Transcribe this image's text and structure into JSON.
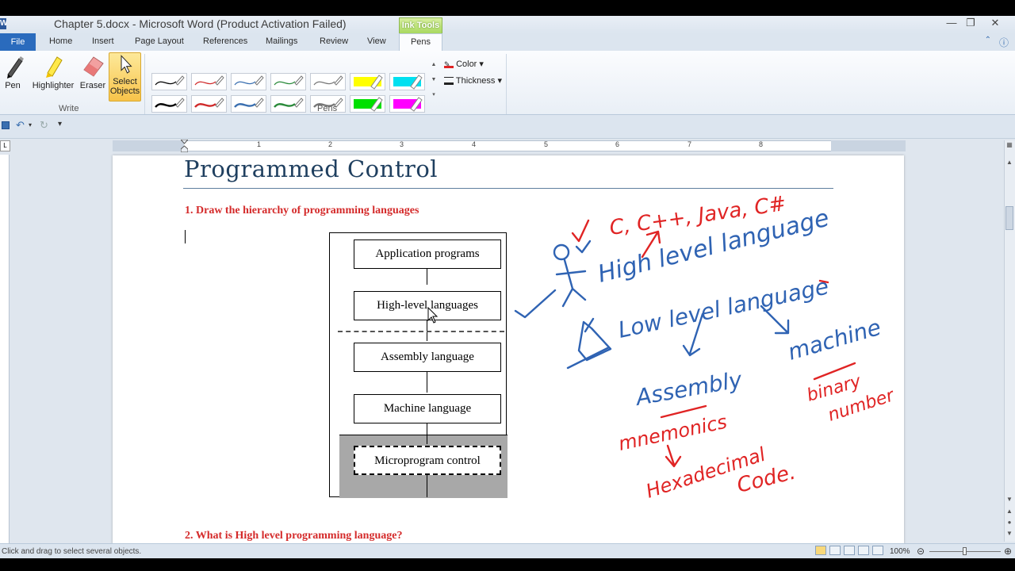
{
  "window": {
    "title": "Chapter 5.docx - Microsoft Word (Product Activation Failed)",
    "app_icon": "W",
    "contextual_tab_group": "Ink Tools",
    "minimize": "—",
    "restore": "❐",
    "close": "✕"
  },
  "tabs": {
    "file": "File",
    "home": "Home",
    "insert": "Insert",
    "page_layout": "Page Layout",
    "references": "References",
    "mailings": "Mailings",
    "review": "Review",
    "view": "View",
    "pens": "Pens"
  },
  "ribbon": {
    "write_group": "Write",
    "pens_group": "Pens",
    "pen": "Pen",
    "highlighter": "Highlighter",
    "eraser": "Eraser",
    "select_objects_1": "Select",
    "select_objects_2": "Objects",
    "color": "Color",
    "thickness": "Thickness",
    "pen_colors_row1": [
      "#000000",
      "#d02a2a",
      "#3a6fb0",
      "#2a8a3a",
      "#777777",
      "#ffff00",
      "#00e0f0"
    ],
    "pen_colors_row2": [
      "#000000",
      "#d02a2a",
      "#3a6fb0",
      "#2a8a3a",
      "#777777",
      "#00e000",
      "#ff00ff"
    ]
  },
  "ruler": {
    "numbers": [
      "1",
      "1",
      "2",
      "3",
      "4",
      "5",
      "6",
      "7",
      "8"
    ]
  },
  "document": {
    "heading": "Programmed Control",
    "question1": "1. Draw the hierarchy of programming languages",
    "question2": "2. What is High level programming language?",
    "diagram": {
      "boxes": [
        "Application programs",
        "High-level languages",
        "Assembly language",
        "Machine language",
        "Microprogram control"
      ]
    },
    "ink": {
      "langs": "C, C++, Java, C#",
      "high_level": "High level language",
      "low_level": "Low level language",
      "assembly": "Assembly",
      "machine": "machine",
      "binary": "binary",
      "number": "number",
      "mnemonics": "mnemonics",
      "hexadecimal": "Hexadecimal",
      "code": "Code."
    }
  },
  "status": {
    "hint": "Click and drag to select several objects.",
    "zoom": "100%"
  },
  "colors": {
    "accent": "#2a6bbd",
    "question_red": "#d42a2a",
    "ink_blue": "#2f63b3",
    "ink_red": "#e02424"
  }
}
